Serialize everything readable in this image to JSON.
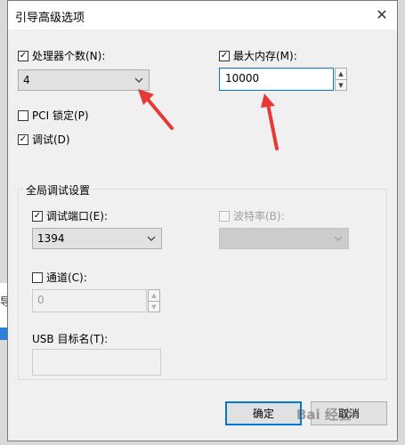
{
  "dialog": {
    "title": "引导高级选项",
    "close_glyph": "✕"
  },
  "background": {
    "partial_label": "导"
  },
  "processor": {
    "label": "处理器个数(N):",
    "checked": true,
    "value": "4"
  },
  "max_memory": {
    "label": "最大内存(M):",
    "checked": true,
    "value": "10000"
  },
  "pci_lock": {
    "label": "PCI 锁定(P)",
    "checked": false
  },
  "debug": {
    "label": "调试(D)",
    "checked": true
  },
  "global_debug": {
    "title": "全局调试设置",
    "debug_port": {
      "label": "调试端口(E):",
      "checked": true,
      "value": "1394"
    },
    "baud_rate": {
      "label": "波特率(B):",
      "checked": false,
      "value": ""
    },
    "channel": {
      "label": "通道(C):",
      "checked": false,
      "value": "0"
    },
    "usb_target": {
      "label": "USB 目标名(T):",
      "value": ""
    }
  },
  "buttons": {
    "ok": "确定",
    "cancel": "取消"
  },
  "watermark": "Bai 经验",
  "colors": {
    "accent": "#0078d7",
    "annotation_arrow": "#e53935"
  }
}
